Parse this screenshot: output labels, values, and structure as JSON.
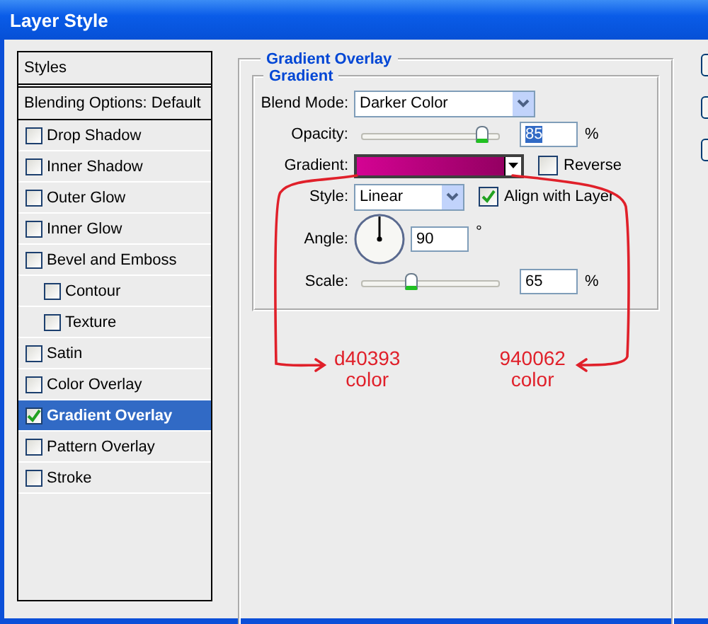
{
  "window": {
    "title": "Layer Style"
  },
  "sidebar": {
    "items": [
      {
        "kind": "header",
        "label": "Styles"
      },
      {
        "kind": "header",
        "label": "Blending Options: Default"
      },
      {
        "kind": "effect",
        "label": "Drop Shadow",
        "checked": false,
        "selected": false
      },
      {
        "kind": "effect",
        "label": "Inner Shadow",
        "checked": false,
        "selected": false
      },
      {
        "kind": "effect",
        "label": "Outer Glow",
        "checked": false,
        "selected": false
      },
      {
        "kind": "effect",
        "label": "Inner Glow",
        "checked": false,
        "selected": false
      },
      {
        "kind": "effect",
        "label": "Bevel and Emboss",
        "checked": false,
        "selected": false,
        "children": [
          {
            "kind": "effect",
            "label": "Contour",
            "checked": false,
            "selected": false
          },
          {
            "kind": "effect",
            "label": "Texture",
            "checked": false,
            "selected": false
          }
        ]
      },
      {
        "kind": "effect",
        "label": "Satin",
        "checked": false,
        "selected": false
      },
      {
        "kind": "effect",
        "label": "Color Overlay",
        "checked": false,
        "selected": false
      },
      {
        "kind": "effect",
        "label": "Gradient Overlay",
        "checked": true,
        "selected": true
      },
      {
        "kind": "effect",
        "label": "Pattern Overlay",
        "checked": false,
        "selected": false
      },
      {
        "kind": "effect",
        "label": "Stroke",
        "checked": false,
        "selected": false
      }
    ]
  },
  "panel": {
    "title": "Gradient Overlay",
    "group": "Gradient",
    "blend_mode": {
      "label": "Blend Mode:",
      "value": "Darker Color"
    },
    "opacity": {
      "label": "Opacity:",
      "value": "85",
      "unit": "%",
      "level": 0.85
    },
    "gradient": {
      "label": "Gradient:",
      "reverse": {
        "label": "Reverse",
        "checked": false
      }
    },
    "style": {
      "label": "Style:",
      "value": "Linear",
      "align": {
        "label": "Align with Layer",
        "checked": true
      }
    },
    "angle": {
      "label": "Angle:",
      "value": "90",
      "unit": "°"
    },
    "scale": {
      "label": "Scale:",
      "value": "65",
      "unit": "%",
      "level": 0.37
    }
  },
  "annotations": [
    {
      "value": "d40393",
      "caption": "color"
    },
    {
      "value": "940062",
      "caption": "color"
    }
  ]
}
